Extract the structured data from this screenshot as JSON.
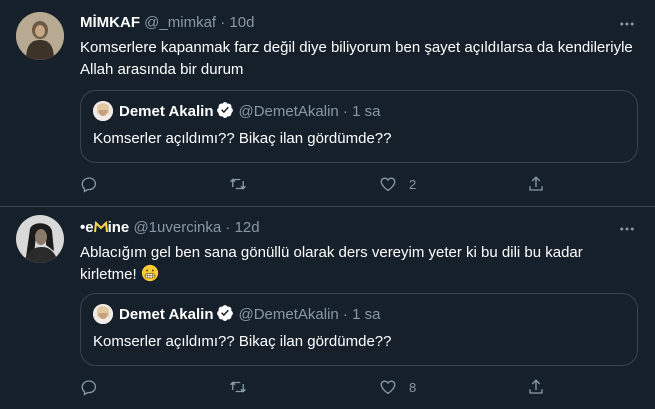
{
  "colors": {
    "background": "#15202b",
    "border": "#38444d",
    "muted": "#8899a6",
    "verified": "#ffffff"
  },
  "tweets": [
    {
      "author_name": "MİMKAF",
      "handle": "@_mimkaf",
      "separator": "·",
      "time": "10d",
      "text": "Komserlere kapanmak farz değil diye biliyorum ben şayet açıldılarsa da kendileriyle Allah arasında bir durum",
      "quote": {
        "author_name": "Demet Akalin",
        "handle": "@DemetAkalin",
        "separator": "·",
        "time": "1 sa",
        "text": "Komserler açıldımı?? Bikaç ilan gördümde??"
      },
      "like_count": "2"
    },
    {
      "author_name_prefix": "•e",
      "author_name_suffix": "ine",
      "handle": "@1uvercinka",
      "separator": "·",
      "time": "12d",
      "text": "Ablacığım gel ben sana gönüllü olarak ders vereyim yeter ki bu dili bu kadar kirletme!",
      "emoji": "grimacing-face-emoji",
      "quote": {
        "author_name": "Demet Akalin",
        "handle": "@DemetAkalin",
        "separator": "·",
        "time": "1 sa",
        "text": "Komserler açıldımı?? Bikaç ilan gördümde??"
      },
      "like_count": "8"
    }
  ],
  "icons": {
    "reply": "reply-icon",
    "retweet": "retweet-icon",
    "like": "heart-icon",
    "share": "share-icon",
    "more": "more-icon",
    "verified": "verified-badge-icon"
  }
}
